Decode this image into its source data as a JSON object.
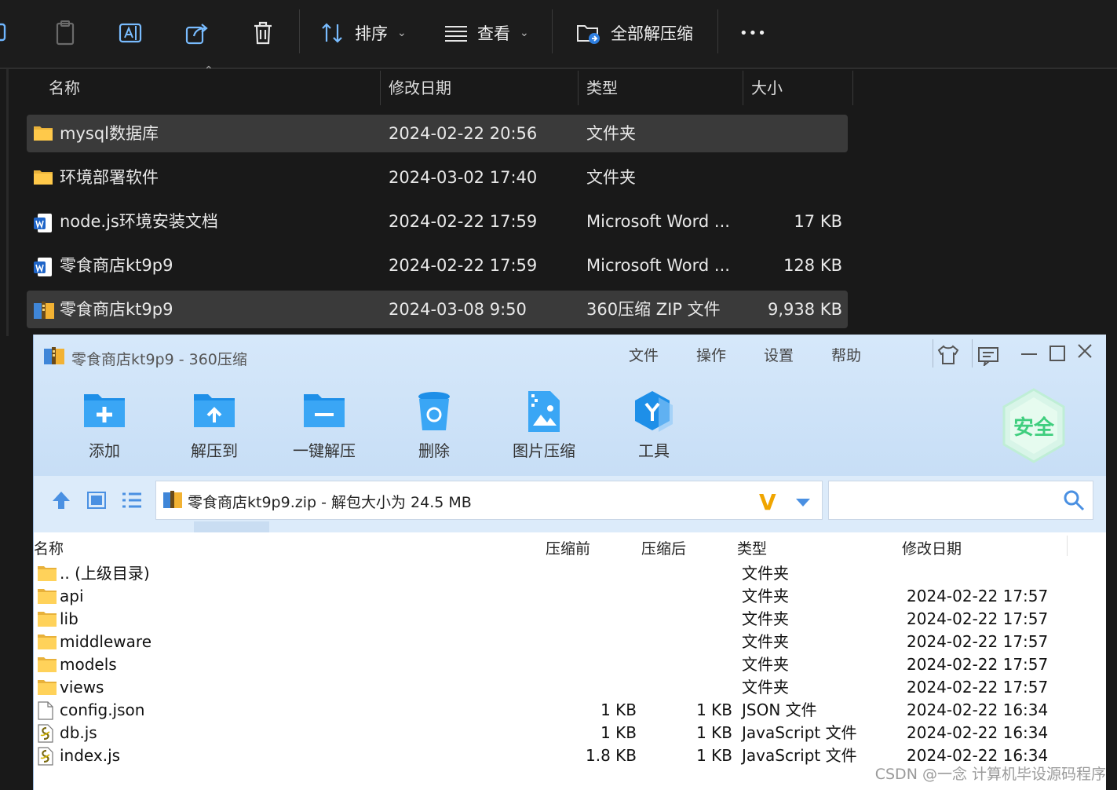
{
  "explorer": {
    "toolbar": {
      "sort_label": "排序",
      "view_label": "查看",
      "extract_all_label": "全部解压缩",
      "more_label": "•••"
    },
    "columns": {
      "name": "名称",
      "modified": "修改日期",
      "type": "类型",
      "size": "大小"
    },
    "files": [
      {
        "name": "mysql数据库",
        "modified": "2024-02-22 20:56",
        "type": "文件夹",
        "size": "",
        "icon": "folder-icon",
        "selected": true
      },
      {
        "name": "环境部署软件",
        "modified": "2024-03-02 17:40",
        "type": "文件夹",
        "size": "",
        "icon": "folder-icon",
        "selected": false
      },
      {
        "name": "node.js环境安装文档",
        "modified": "2024-02-22 17:59",
        "type": "Microsoft Word ...",
        "size": "17 KB",
        "icon": "word-doc-icon",
        "selected": false
      },
      {
        "name": "零食商店kt9p9",
        "modified": "2024-02-22 17:59",
        "type": "Microsoft Word ...",
        "size": "128 KB",
        "icon": "word-doc-icon",
        "selected": false
      },
      {
        "name": "零食商店kt9p9",
        "modified": "2024-03-08 9:50",
        "type": "360压缩 ZIP 文件",
        "size": "9,938 KB",
        "icon": "zip-archive-icon",
        "selected": true
      }
    ]
  },
  "zip": {
    "title": "零食商店kt9p9 - 360压缩",
    "menu": [
      "文件",
      "操作",
      "设置",
      "帮助"
    ],
    "tools": [
      "添加",
      "解压到",
      "一键解压",
      "删除",
      "图片压缩",
      "工具"
    ],
    "security_badge": "安全",
    "address": "零食商店kt9p9.zip - 解包大小为 24.5 MB",
    "columns": {
      "name": "名称",
      "before": "压缩前",
      "after": "压缩后",
      "type": "类型",
      "modified": "修改日期"
    },
    "rows": [
      {
        "name": ".. (上级目录)",
        "before": "",
        "after": "",
        "type": "文件夹",
        "modified": "",
        "icon": "folder-icon"
      },
      {
        "name": "api",
        "before": "",
        "after": "",
        "type": "文件夹",
        "modified": "2024-02-22 17:57",
        "icon": "folder-icon"
      },
      {
        "name": "lib",
        "before": "",
        "after": "",
        "type": "文件夹",
        "modified": "2024-02-22 17:57",
        "icon": "folder-icon"
      },
      {
        "name": "middleware",
        "before": "",
        "after": "",
        "type": "文件夹",
        "modified": "2024-02-22 17:57",
        "icon": "folder-icon"
      },
      {
        "name": "models",
        "before": "",
        "after": "",
        "type": "文件夹",
        "modified": "2024-02-22 17:57",
        "icon": "folder-icon"
      },
      {
        "name": "views",
        "before": "",
        "after": "",
        "type": "文件夹",
        "modified": "2024-02-22 17:57",
        "icon": "folder-icon"
      },
      {
        "name": "config.json",
        "before": "1 KB",
        "after": "1 KB",
        "type": "JSON 文件",
        "modified": "2024-02-22 16:34",
        "icon": "blank-file-icon"
      },
      {
        "name": "db.js",
        "before": "1 KB",
        "after": "1 KB",
        "type": "JavaScript 文件",
        "modified": "2024-02-22 16:34",
        "icon": "script-file-icon"
      },
      {
        "name": "index.js",
        "before": "1.8 KB",
        "after": "1 KB",
        "type": "JavaScript 文件",
        "modified": "2024-02-22 16:34",
        "icon": "script-file-icon"
      }
    ]
  },
  "watermark": "CSDN @一念 计算机毕设源码程序"
}
